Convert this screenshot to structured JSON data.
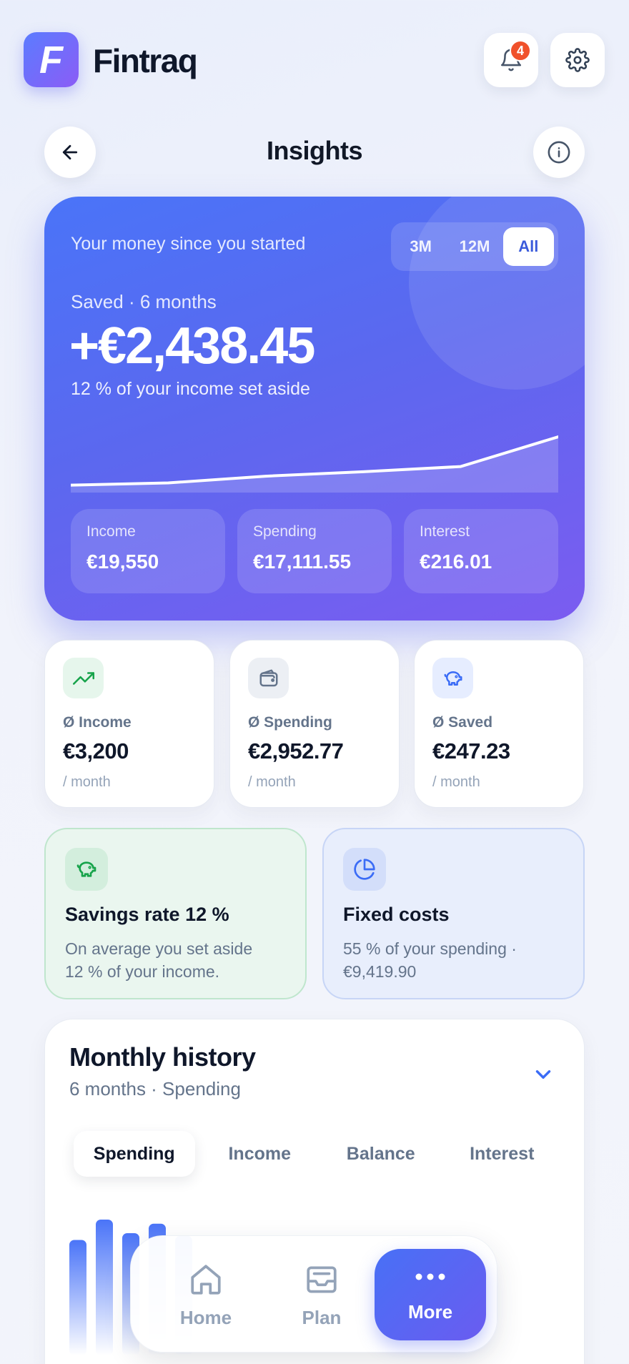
{
  "header": {
    "logo_letter": "F",
    "app_name": "Fintraq",
    "notifications_count": "4"
  },
  "page": {
    "title": "Insights"
  },
  "hero": {
    "label": "Your money since you started",
    "ranges": [
      "3M",
      "12M",
      "All"
    ],
    "selected_range": "All",
    "subtitle": "Saved · 6 months",
    "amount": "+€2,438.45",
    "note": "12 % of your income set aside",
    "trend": [
      0.1,
      0.13,
      0.22,
      0.28,
      0.35,
      0.75
    ],
    "stats": [
      {
        "label": "Income",
        "value": "€19,550"
      },
      {
        "label": "Spending",
        "value": "€17,111.55"
      },
      {
        "label": "Interest",
        "value": "€216.01"
      }
    ]
  },
  "averages": [
    {
      "icon": "trending-up-icon",
      "label": "Ø Income",
      "value": "€3,200",
      "unit": "/ month",
      "icon_bg": "#e6f6ec",
      "icon_color": "#16a34a"
    },
    {
      "icon": "wallet-icon",
      "label": "Ø Spending",
      "value": "€2,952.77",
      "unit": "/ month",
      "icon_bg": "#eceff4",
      "icon_color": "#64748b"
    },
    {
      "icon": "piggy-bank-icon",
      "label": "Ø Saved",
      "value": "€247.23",
      "unit": "/ month",
      "icon_bg": "#e6edff",
      "icon_color": "#3b6cf6"
    }
  ],
  "info_cards": [
    {
      "icon": "piggy-bank-icon",
      "title": "Savings rate 12 %",
      "text_line1": "On average you set aside",
      "text_line2": "12 % of your income.",
      "bg": "#eaf6ef",
      "border": "#bfe6cd"
    },
    {
      "icon": "pie-chart-icon",
      "title": "Fixed costs",
      "text_line1": "55 % of your spending ·",
      "text_line2": "€9,419.90",
      "bg": "#e8eefc",
      "border": "#c7d5f6"
    }
  ],
  "history": {
    "title": "Monthly history",
    "subtitle": "6 months · Spending",
    "tabs": [
      "Spending",
      "Income",
      "Balance",
      "Interest"
    ],
    "active_tab": "Spending",
    "bars": [
      0.85,
      1.0,
      0.9,
      0.97,
      0.88
    ]
  },
  "nav": {
    "items": [
      "Home",
      "Plan",
      "More"
    ],
    "active": "More"
  },
  "colors": {
    "accent": "#4a74f8",
    "accent2": "#7b5cf0",
    "badge": "#f0512b"
  }
}
